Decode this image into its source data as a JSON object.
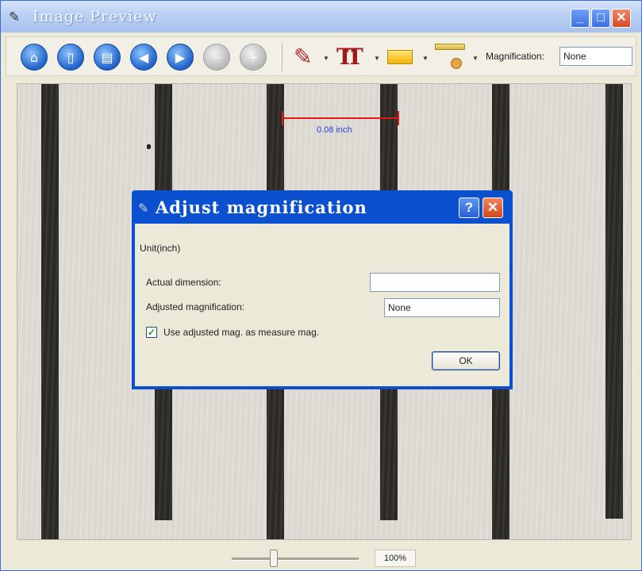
{
  "window": {
    "title": "Image Preview",
    "controls": {
      "minimize": "_",
      "maximize": "□",
      "close": "✕"
    }
  },
  "toolbar": {
    "buttons": [
      {
        "name": "home-button",
        "icon": "home-icon",
        "style": "blue",
        "glyph": "⌂"
      },
      {
        "name": "new-button",
        "icon": "document-icon",
        "style": "blue",
        "glyph": "▯"
      },
      {
        "name": "print-button",
        "icon": "print-icon",
        "style": "blue",
        "glyph": "▤"
      },
      {
        "name": "back-button",
        "icon": "back-arrow-icon",
        "style": "blue",
        "glyph": "◀"
      },
      {
        "name": "forward-button",
        "icon": "forward-arrow-icon",
        "style": "blue",
        "glyph": "▶"
      },
      {
        "name": "zoom-out-button",
        "icon": "minus-icon",
        "style": "grey",
        "glyph": "−"
      },
      {
        "name": "zoom-in-button",
        "icon": "plus-icon",
        "style": "grey",
        "glyph": "+"
      }
    ],
    "tools": [
      {
        "name": "pencil-tool",
        "icon": "pencil-icon",
        "glyph": "✎"
      },
      {
        "name": "text-tool",
        "icon": "text-icon",
        "glyph": "TT"
      },
      {
        "name": "color-tool",
        "icon": "color-swatch-icon",
        "glyph": ""
      },
      {
        "name": "measure-tool",
        "icon": "ruler-icon",
        "glyph": ""
      }
    ],
    "magnification_label": "Magnification:",
    "magnification_value": "None"
  },
  "image": {
    "measurement_label": "0.08 inch"
  },
  "dialog": {
    "title": "Adjust magnification",
    "help_label": "?",
    "close_label": "✕",
    "unit_label": "Unit(inch)",
    "actual_dimension_label": "Actual dimension:",
    "actual_dimension_value": "",
    "adjusted_magnification_label": "Adjusted magnification:",
    "adjusted_magnification_value": "None",
    "checkbox_label": "Use adjusted mag. as measure mag.",
    "checkbox_checked": true,
    "ok_label": "OK"
  },
  "statusbar": {
    "zoom_percent": "100%",
    "zoom_slider_fraction": 0.33
  },
  "colors": {
    "title_bar": "#b9cff3",
    "dialog_title_bar": "#0a50cf",
    "measure_line": "#e01919",
    "measure_text": "#2b3fd6"
  }
}
